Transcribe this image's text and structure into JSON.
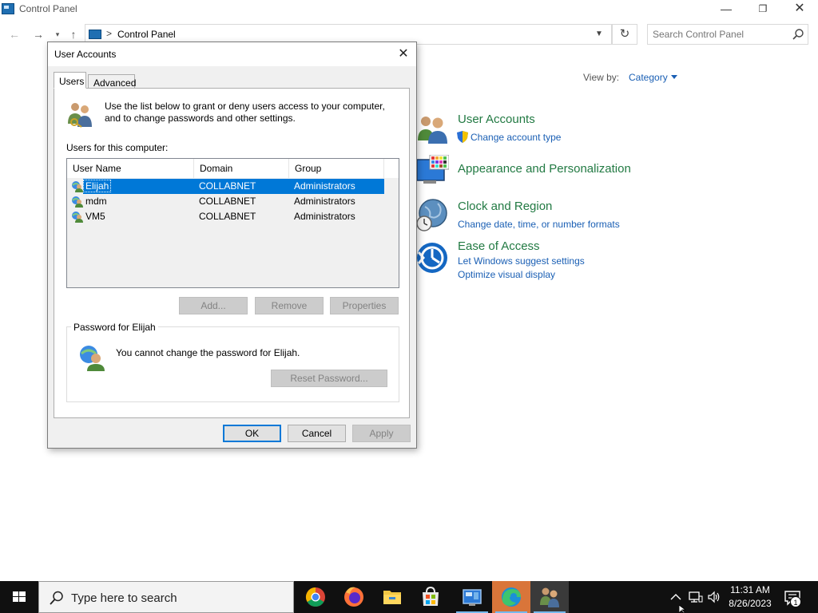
{
  "control_panel": {
    "title": "Control Panel",
    "address": {
      "separator": ">",
      "path": "Control Panel"
    },
    "search_placeholder": "Search Control Panel",
    "view_by": {
      "label": "View by:",
      "value": "Category"
    },
    "categories": [
      {
        "title": "User Accounts",
        "icon": "user-accounts-icon",
        "links": [
          "Change account type"
        ]
      },
      {
        "title": "Appearance and Personalization",
        "icon": "appearance-icon",
        "links": []
      },
      {
        "title": "Clock and Region",
        "icon": "clock-region-icon",
        "links": [
          "Change date, time, or number formats"
        ]
      },
      {
        "title": "Ease of Access",
        "icon": "ease-of-access-icon",
        "links": [
          "Let Windows suggest settings",
          "Optimize visual display"
        ]
      }
    ]
  },
  "dialog": {
    "title": "User Accounts",
    "tabs": [
      {
        "label": "Users",
        "active": true
      },
      {
        "label": "Advanced",
        "active": false
      }
    ],
    "intro": "Use the list below to grant or deny users access to your computer, and to change passwords and other settings.",
    "users_label": "Users for this computer:",
    "columns": [
      "User Name",
      "Domain",
      "Group"
    ],
    "users": [
      {
        "name": "Elijah",
        "domain": "COLLABNET",
        "group": "Administrators",
        "selected": true
      },
      {
        "name": "mdm",
        "domain": "COLLABNET",
        "group": "Administrators",
        "selected": false
      },
      {
        "name": "VM5",
        "domain": "COLLABNET",
        "group": "Administrators",
        "selected": false
      }
    ],
    "buttons": {
      "add": "Add...",
      "remove": "Remove",
      "properties": "Properties"
    },
    "password_group": {
      "label": "Password for Elijah",
      "message": "You cannot change the password for Elijah.",
      "reset_button": "Reset Password..."
    },
    "footer": {
      "ok": "OK",
      "cancel": "Cancel",
      "apply": "Apply"
    }
  },
  "taskbar": {
    "search_placeholder": "Type here to search",
    "apps": [
      "chrome-icon",
      "firefox-icon",
      "file-explorer-icon",
      "store-icon",
      "control-panel-icon",
      "edge-icon",
      "user-accounts-icon"
    ],
    "clock": {
      "time": "11:31 AM",
      "date": "8/26/2023"
    },
    "notification_count": "1"
  },
  "colors": {
    "accent": "#0078d7",
    "category_title": "#227a43",
    "link": "#1a5fb4",
    "taskbar": "#101010"
  }
}
